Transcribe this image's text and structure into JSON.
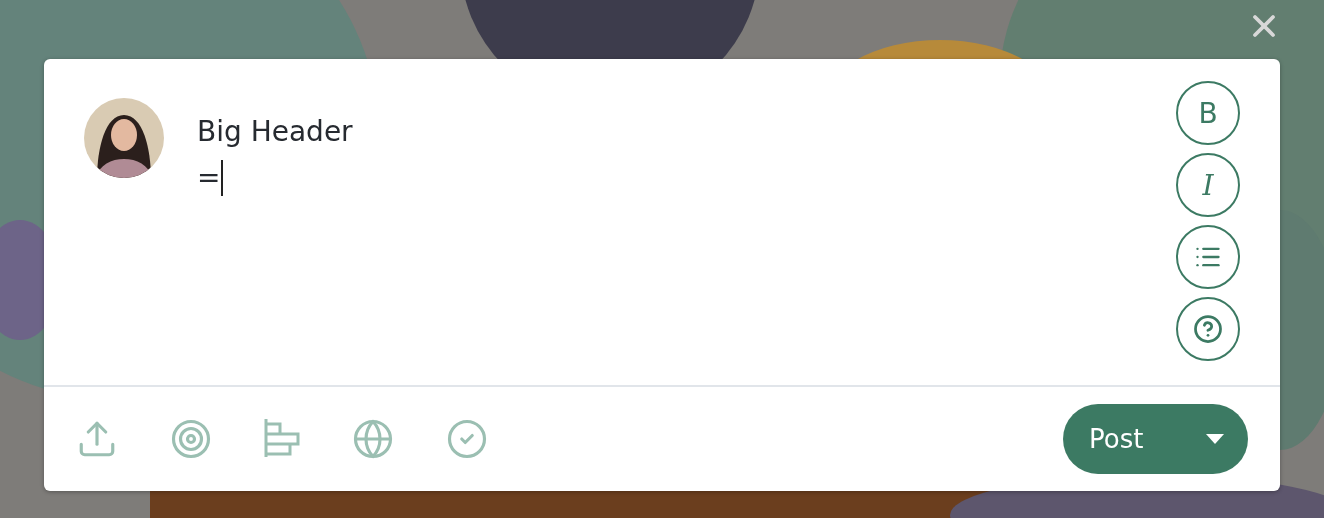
{
  "editor": {
    "lines": [
      "Big Header",
      "="
    ],
    "caret": true
  },
  "format_buttons": [
    {
      "kind": "bold",
      "label": "B"
    },
    {
      "kind": "italic",
      "label": "I"
    }
  ],
  "post_button": {
    "label": "Post"
  }
}
